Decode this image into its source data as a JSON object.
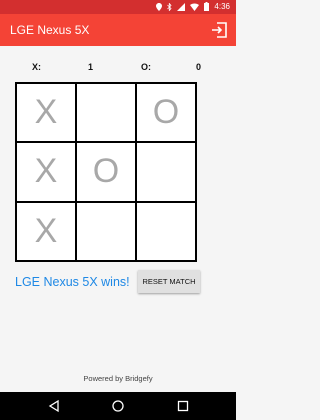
{
  "status_bar": {
    "time": "4:36",
    "icons": [
      "location-icon",
      "bluetooth-icon",
      "signal-icon",
      "wifi-icon",
      "battery-icon"
    ]
  },
  "app_bar": {
    "title": "LGE Nexus 5X",
    "action_icon": "exit-icon"
  },
  "score": {
    "x_label": "X:",
    "x_value": "1",
    "o_label": "O:",
    "o_value": "0"
  },
  "board": {
    "cells": [
      "X",
      "",
      "O",
      "X",
      "O",
      "",
      "X",
      "",
      ""
    ]
  },
  "result": {
    "winner_text": "LGE Nexus 5X wins!",
    "reset_label": "RESET MATCH"
  },
  "footer": {
    "text": "Powered by Bridgefy"
  },
  "colors": {
    "status_bar": "#d32f2f",
    "app_bar": "#f44336",
    "winner_text": "#1e88e5",
    "mark": "#a8a8a8"
  }
}
